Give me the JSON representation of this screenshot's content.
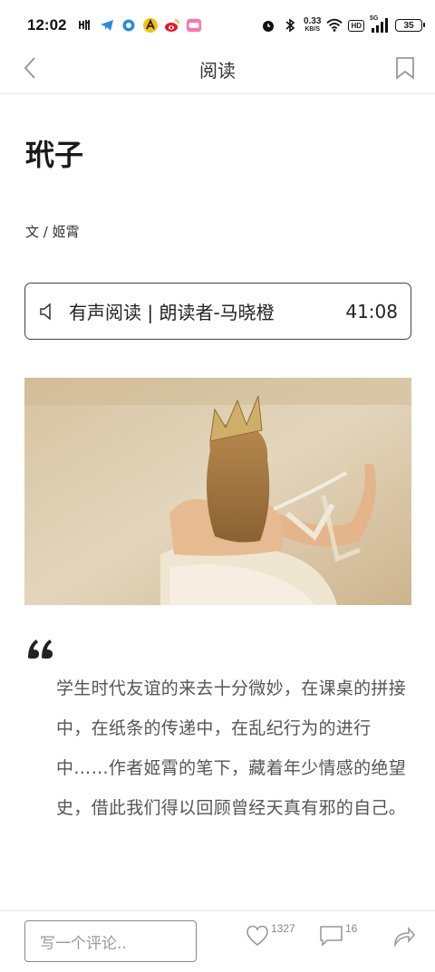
{
  "status_bar": {
    "time": "12:02",
    "net_speed_value": "0.33",
    "net_speed_unit": "KB/S",
    "hd_label": "HD",
    "signal_label": "5G",
    "battery": "35"
  },
  "nav": {
    "title": "阅读"
  },
  "article": {
    "title": "玳子",
    "byline": "文 / 姬霄"
  },
  "audio": {
    "label": "有声阅读 | 朗读者-马晓橙",
    "duration": "41:08"
  },
  "summary": "学生时代友谊的来去十分微妙，在课桌的拼接中，在纸条的传递中，在乱纪行为的进行中……作者姬霄的笔下，藏着年少情感的绝望史，借此我们得以回顾曾经天真有邪的自己。",
  "bottom_bar": {
    "comment_placeholder": "写一个评论..",
    "like_count": "1327",
    "comment_count": "16"
  },
  "colors": {
    "photo_bg": "#d7c6a4",
    "text_primary": "#222222",
    "text_secondary": "#555555",
    "divider": "#e6e6e6"
  },
  "icons": [
    "tiktok-icon",
    "telegram-icon",
    "circle-app-icon",
    "yellow-app-icon",
    "weibo-icon",
    "pink-app-icon",
    "alarm-icon",
    "bluetooth-icon",
    "wifi-icon",
    "signal-icon",
    "back-icon",
    "bookmark-icon",
    "speaker-icon",
    "quote-icon",
    "heart-icon",
    "comment-icon",
    "share-icon"
  ]
}
